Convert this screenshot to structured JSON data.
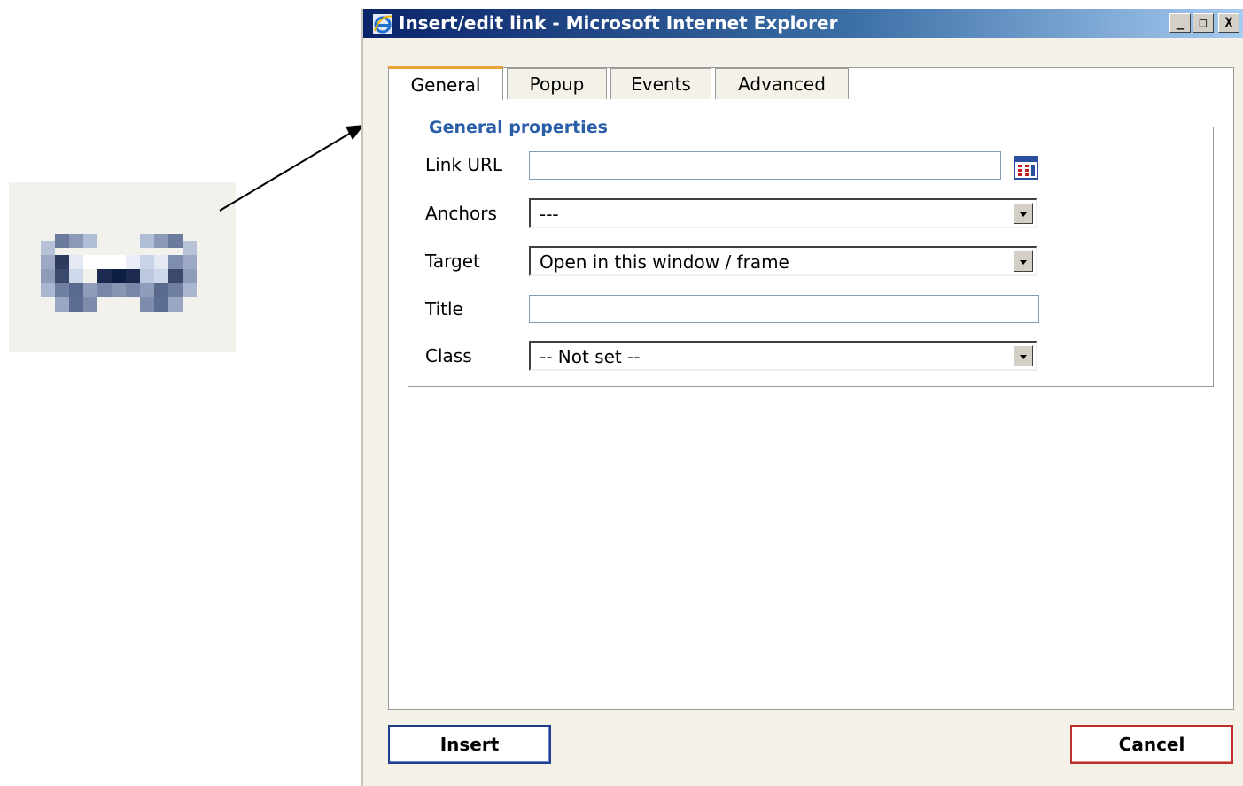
{
  "window": {
    "title": "Insert/edit link - Microsoft Internet Explorer",
    "controls": {
      "minimize": "_",
      "maximize": "□",
      "close": "X"
    }
  },
  "tabs": [
    {
      "label": "General",
      "active": true
    },
    {
      "label": "Popup",
      "active": false
    },
    {
      "label": "Events",
      "active": false
    },
    {
      "label": "Advanced",
      "active": false
    }
  ],
  "general": {
    "legend": "General properties",
    "link_url": {
      "label": "Link URL",
      "value": ""
    },
    "anchors": {
      "label": "Anchors",
      "value": "---"
    },
    "target": {
      "label": "Target",
      "value": "Open in this window / frame"
    },
    "title": {
      "label": "Title",
      "value": ""
    },
    "class": {
      "label": "Class",
      "value": "-- Not set --"
    }
  },
  "footer": {
    "insert_label": "Insert",
    "cancel_label": "Cancel"
  },
  "icons": {
    "link": "link-icon",
    "browse": "browse-icon",
    "app": "internet-explorer-icon"
  },
  "colors": {
    "titlebar_start": "#0a246a",
    "titlebar_end": "#a6caf0",
    "legend": "#2a5ea8",
    "active_tab_accent": "#e8a23a",
    "insert_border": "#1f3e8c",
    "cancel_border": "#c0302c"
  }
}
